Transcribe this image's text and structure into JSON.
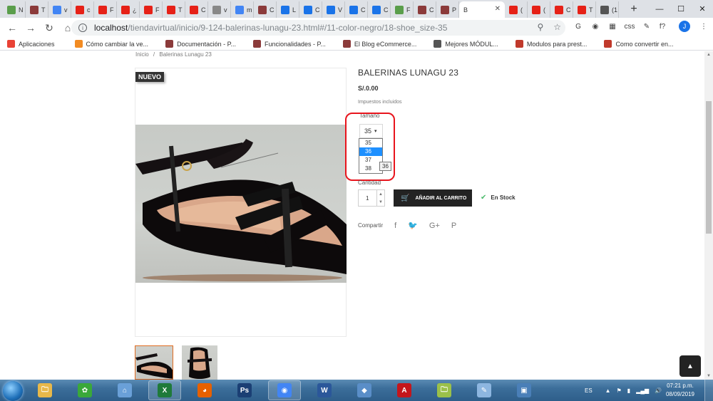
{
  "browser": {
    "tabs": [
      {
        "label": "N",
        "color": "#5a9e4b"
      },
      {
        "label": "T",
        "color": "#8b3a3a"
      },
      {
        "label": "v",
        "color": "#4285f4"
      },
      {
        "label": "c",
        "color": "#e62117"
      },
      {
        "label": "F",
        "color": "#e62117"
      },
      {
        "label": "¿",
        "color": "#e62117"
      },
      {
        "label": "F",
        "color": "#e62117"
      },
      {
        "label": "T",
        "color": "#e62117"
      },
      {
        "label": "C",
        "color": "#e62117"
      },
      {
        "label": "v",
        "color": "#888888"
      },
      {
        "label": "m",
        "color": "#4285f4"
      },
      {
        "label": "C",
        "color": "#8b3a3a"
      },
      {
        "label": "L",
        "color": "#1a73e8"
      },
      {
        "label": "C",
        "color": "#1a73e8"
      },
      {
        "label": "V",
        "color": "#1a73e8"
      },
      {
        "label": "C",
        "color": "#1a73e8"
      },
      {
        "label": "C",
        "color": "#1a73e8"
      },
      {
        "label": "F",
        "color": "#5a9e4b"
      },
      {
        "label": "C",
        "color": "#8b3a3a"
      },
      {
        "label": "P",
        "color": "#8b3a3a"
      }
    ],
    "active_tab": {
      "label": "B",
      "close": "✕"
    },
    "tabs_after": [
      {
        "label": "(",
        "color": "#e62117"
      },
      {
        "label": "(",
        "color": "#e62117"
      },
      {
        "label": "C",
        "color": "#e62117"
      },
      {
        "label": "T",
        "color": "#e62117"
      },
      {
        "label": "(1",
        "color": "#555555"
      }
    ],
    "new_tab": "+",
    "window_controls": {
      "minimize": "—",
      "maximize": "☐",
      "close": "✕"
    },
    "nav": {
      "back": "←",
      "forward": "→",
      "reload": "↻",
      "home": "⌂"
    },
    "url": {
      "host": "localhost",
      "path": "/tiendavirtual/inicio/9-124-balerinas-lunagu-23.html#/11-color-negro/18-shoe_size-35"
    },
    "omnibox_icons": {
      "info": "i",
      "zoom": "⚲",
      "star": "☆"
    },
    "extensions": [
      "G",
      "◉",
      "▦",
      "css",
      "✎",
      "f?"
    ],
    "avatar": "J",
    "menu": "⋮",
    "bookmarks": [
      {
        "label": "Aplicaciones",
        "color": "#e94235"
      },
      {
        "label": "Cómo cambiar la ve...",
        "color": "#f28b22"
      },
      {
        "label": "Documentación - P...",
        "color": "#8b3a3a"
      },
      {
        "label": "Funcionalidades - P...",
        "color": "#8b3a3a"
      },
      {
        "label": "El Blog eCommerce...",
        "color": "#8b3a3a"
      },
      {
        "label": "Mejores MÓDUL...",
        "color": "#555555"
      },
      {
        "label": "Modulos para prest...",
        "color": "#c0392b"
      },
      {
        "label": "Como convertir en...",
        "color": "#c0392b"
      }
    ]
  },
  "page": {
    "breadcrumb": {
      "home": "Inicio",
      "sep": "/",
      "current": "Balerinas Lunagu 23"
    },
    "badge": "NUEVO",
    "title": "BALERINAS LUNAGU 23",
    "price": "S/.0.00",
    "tax": "Impuestos incluidos",
    "size_label": "Tamaño",
    "size_selected": "35",
    "size_caret": "▾",
    "size_options": [
      "35",
      "36",
      "37",
      "38"
    ],
    "size_highlighted": "36",
    "tooltip": "36",
    "qty_label": "Cantidad",
    "qty_value": "1",
    "qty_up": "▲",
    "qty_down": "▼",
    "cart_icon": "🛒",
    "cart_button": "AÑADIR AL CARRITO",
    "stock_check": "✔",
    "stock": "En Stock",
    "share_label": "Compartir",
    "share_icons": {
      "facebook": "f",
      "twitter": "🐦",
      "googleplus": "G+",
      "pinterest": "P"
    },
    "scroll_top": "▲"
  },
  "taskbar": {
    "apps": [
      {
        "name": "folder",
        "glyph": "🗀",
        "color": "#e8b84a"
      },
      {
        "name": "green",
        "glyph": "✿",
        "color": "#3aa83a"
      },
      {
        "name": "network",
        "glyph": "⌂",
        "color": "#6aa0d8"
      },
      {
        "name": "excel",
        "glyph": "X",
        "color": "#1f7a3a"
      },
      {
        "name": "firefox",
        "glyph": "◕",
        "color": "#e66000"
      },
      {
        "name": "photoshop",
        "glyph": "Ps",
        "color": "#1b3f74"
      },
      {
        "name": "chrome",
        "glyph": "◉",
        "color": "#4285f4"
      },
      {
        "name": "word",
        "glyph": "W",
        "color": "#2b579a"
      },
      {
        "name": "app",
        "glyph": "◆",
        "color": "#5a8ec8"
      },
      {
        "name": "acrobat",
        "glyph": "A",
        "color": "#c4161c"
      },
      {
        "name": "folder2",
        "glyph": "🗀",
        "color": "#9bc04a"
      },
      {
        "name": "paint",
        "glyph": "✎",
        "color": "#8db6e0"
      },
      {
        "name": "window",
        "glyph": "▣",
        "color": "#4a7fb8"
      }
    ],
    "lang": "ES",
    "tray_icons": [
      "▲",
      "⚑",
      "▮",
      "▂▄▆",
      "🔊"
    ],
    "time": "07:21 p.m.",
    "date": "08/09/2019"
  }
}
